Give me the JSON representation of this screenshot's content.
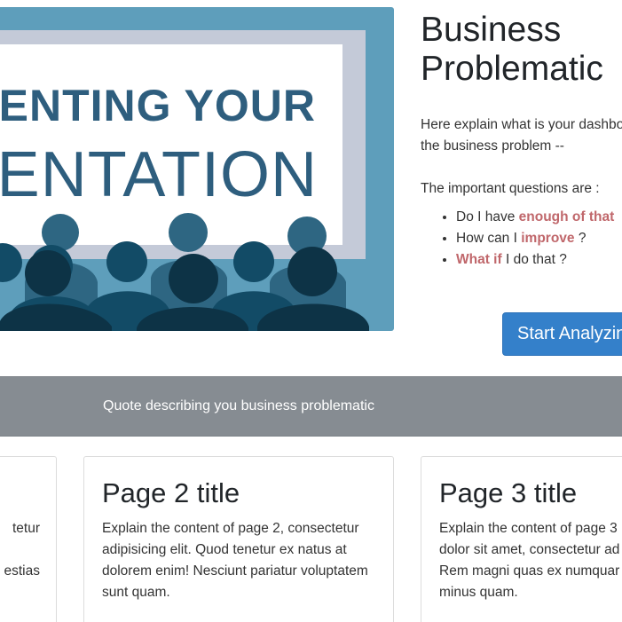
{
  "hero": {
    "banner_line1": "ENTING YOUR",
    "banner_line2": "ENTATION",
    "colors": {
      "frame": "#5e9ebb",
      "screen_border": "#c4cad8",
      "text": "#2e5e7e",
      "audience_dark": "#0d3346"
    }
  },
  "intro": {
    "title_line1": "Business",
    "title_line2": "Problematic",
    "desc_line1": "Here explain what is your dashbo",
    "desc_line2": "the business problem --",
    "questions_heading": "The important questions are :",
    "questions": [
      {
        "pre": "Do I have ",
        "hl": "enough of that",
        "post": ""
      },
      {
        "pre": "How can I ",
        "hl": "improve",
        "post": " ?"
      },
      {
        "pre": "",
        "hl": "What if",
        "post": " I do that ?"
      }
    ],
    "start_button": "Start Analyzin"
  },
  "quote": {
    "text": "Quote describing you business problematic"
  },
  "cards": [
    {
      "lines": [
        "tetur",
        "",
        "estias"
      ]
    },
    {
      "title": "Page 2 title",
      "body": "Explain the content of page 2, consectetur adipisicing elit. Quod tenetur ex natus at dolorem enim! Nesciunt pariatur voluptatem sunt quam."
    },
    {
      "title": "Page 3 title",
      "lines": [
        "Explain the content of page 3",
        "dolor sit amet, consectetur ad",
        "Rem magni quas ex numquar",
        "minus quam."
      ]
    }
  ],
  "colors": {
    "highlight": "#c0676b",
    "button": "#3480ca",
    "quote_band": "#868c92"
  }
}
